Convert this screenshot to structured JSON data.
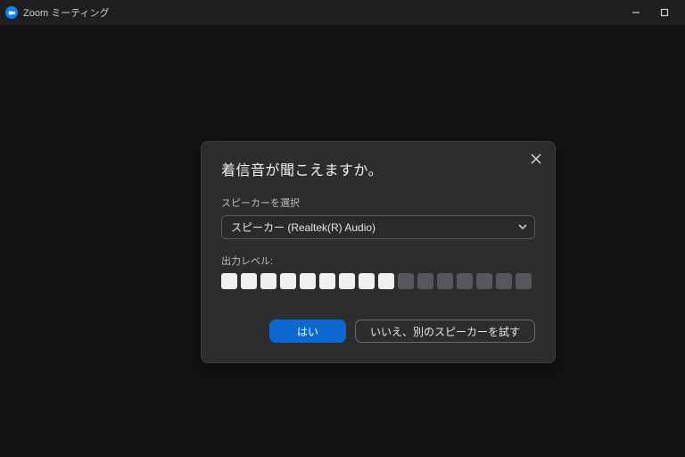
{
  "titlebar": {
    "title": "Zoom ミーティング"
  },
  "modal": {
    "title": "着信音が聞こえますか。",
    "select_label": "スピーカーを選択",
    "select_value": "スピーカー (Realtek(R) Audio)",
    "output_level_label": "出力レベル:",
    "level_total": 16,
    "level_active": 9,
    "yes_label": "はい",
    "no_label": "いいえ、別のスピーカーを試す"
  }
}
